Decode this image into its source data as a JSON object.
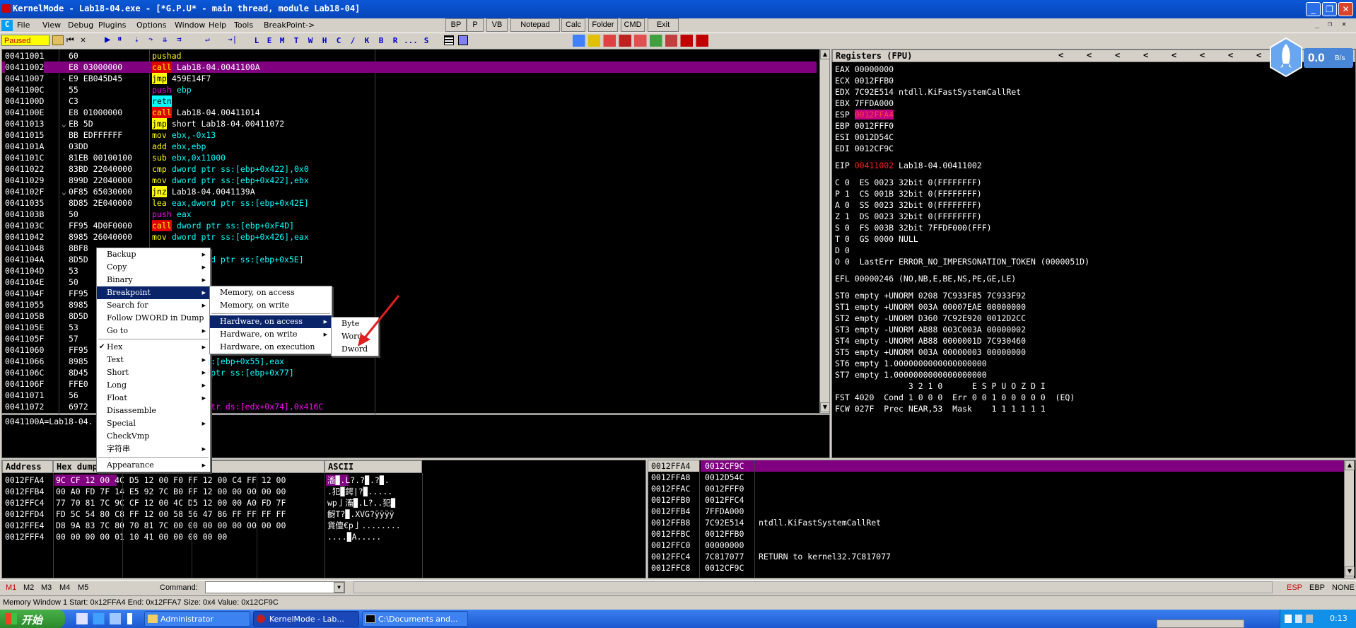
{
  "window": {
    "title": "KernelMode - Lab18-04.exe - [*G.P.U* - main thread, module Lab18-04]"
  },
  "menu": [
    "File",
    "View",
    "Debug",
    "Plugins",
    "Options",
    "Window",
    "Help",
    "Tools",
    "BreakPoint->"
  ],
  "top_buttons": [
    "BP",
    "P",
    "VB",
    "Notepad",
    "Calc",
    "Folder",
    "CMD",
    "Exit"
  ],
  "status_box": "Paused",
  "toolbar_letters": [
    "L",
    "E",
    "M",
    "T",
    "W",
    "H",
    "C",
    "/",
    "K",
    "B",
    "R",
    "...",
    "S"
  ],
  "cpu": {
    "rows": [
      {
        "addr": "00411001",
        "hex": "60",
        "mark": "",
        "mn": "pushad",
        "mncls": "kw-mov",
        "ops": "",
        "opcls": "ops-white"
      },
      {
        "addr": "00411002",
        "hex": "E8 03000000",
        "mark": "",
        "mn": "call",
        "mncls": "kw-call",
        "ops": " Lab18-04.0041100A",
        "opcls": "ops-white",
        "sel": true
      },
      {
        "addr": "00411007",
        "hex": "E9 EB045D45",
        "mark": "-",
        "mn": "jmp",
        "mncls": "kw-jmp",
        "ops": " 459E14F7",
        "opcls": "ops-white"
      },
      {
        "addr": "0041100C",
        "hex": "55",
        "mark": "",
        "mn": "push",
        "mncls": "kw-push",
        "ops": " ebp",
        "opcls": "ops-cyan"
      },
      {
        "addr": "0041100D",
        "hex": "C3",
        "mark": "",
        "mn": "retn",
        "mncls": "kw-retn",
        "ops": "",
        "opcls": "ops-white"
      },
      {
        "addr": "0041100E",
        "hex": "E8 01000000",
        "mark": "",
        "mn": "call",
        "mncls": "kw-call",
        "ops": " Lab18-04.00411014",
        "opcls": "ops-white"
      },
      {
        "addr": "00411013",
        "hex": "EB 5D",
        "mark": "⌄",
        "mn": "jmp",
        "mncls": "kw-jmp",
        "ops": " short Lab18-04.00411072",
        "opcls": "ops-white"
      },
      {
        "addr": "00411015",
        "hex": "BB EDFFFFFF",
        "mark": "",
        "mn": "mov",
        "mncls": "kw-mov",
        "ops": " ebx,-0x13",
        "opcls": "ops-cyan"
      },
      {
        "addr": "0041101A",
        "hex": "03DD",
        "mark": "",
        "mn": "add",
        "mncls": "kw-add",
        "ops": " ebx,ebp",
        "opcls": "ops-cyan"
      },
      {
        "addr": "0041101C",
        "hex": "81EB 00100100",
        "mark": "",
        "mn": "sub",
        "mncls": "kw-sub",
        "ops": " ebx,0x11000",
        "opcls": "ops-cyan"
      },
      {
        "addr": "00411022",
        "hex": "83BD 22040000",
        "mark": "",
        "mn": "cmp",
        "mncls": "kw-cmp",
        "ops": " dword ptr ss:[ebp+0x422],0x0",
        "opcls": "ops-cyan"
      },
      {
        "addr": "00411029",
        "hex": "899D 22040000",
        "mark": "",
        "mn": "mov",
        "mncls": "kw-mov",
        "ops": " dword ptr ss:[ebp+0x422],ebx",
        "opcls": "ops-cyan"
      },
      {
        "addr": "0041102F",
        "hex": "0F85 65030000",
        "mark": "⌄",
        "mn": "jnz",
        "mncls": "kw-jnz",
        "ops": " Lab18-04.0041139A",
        "opcls": "ops-white"
      },
      {
        "addr": "00411035",
        "hex": "8D85 2E040000",
        "mark": "",
        "mn": "lea",
        "mncls": "kw-lea",
        "ops": " eax,dword ptr ss:[ebp+0x42E]",
        "opcls": "ops-cyan"
      },
      {
        "addr": "0041103B",
        "hex": "50",
        "mark": "",
        "mn": "push",
        "mncls": "kw-push",
        "ops": " eax",
        "opcls": "ops-cyan"
      },
      {
        "addr": "0041103C",
        "hex": "FF95 4D0F0000",
        "mark": "",
        "mn": "call",
        "mncls": "kw-call",
        "ops": " dword ptr ss:[ebp+0xF4D]",
        "opcls": "ops-cyan"
      },
      {
        "addr": "00411042",
        "hex": "8985 26040000",
        "mark": "",
        "mn": "mov",
        "mncls": "kw-mov",
        "ops": " dword ptr ss:[ebp+0x426],eax",
        "opcls": "ops-cyan"
      },
      {
        "addr": "00411048",
        "hex": "8BF8",
        "mark": "",
        "mn": "",
        "mncls": "",
        "ops": "",
        "opcls": "ops-white"
      },
      {
        "addr": "0041104A",
        "hex": "8D5D",
        "mark": "",
        "mn": "",
        "mncls": "",
        "ops": "        dword ptr ss:[ebp+0x5E]",
        "opcls": "ops-cyan"
      },
      {
        "addr": "0041104D",
        "hex": "53",
        "mark": "",
        "mn": "",
        "mncls": "",
        "ops": "",
        "opcls": "ops-white"
      },
      {
        "addr": "0041104E",
        "hex": "50",
        "mark": "",
        "mn": "",
        "mncls": "",
        "ops": "",
        "opcls": "ops-white"
      },
      {
        "addr": "0041104F",
        "hex": "FF95",
        "mark": "",
        "mn": "",
        "mncls": "",
        "ops": "",
        "opcls": "ops-white"
      },
      {
        "addr": "00411055",
        "hex": "8985",
        "mark": "",
        "mn": "",
        "mncls": "",
        "ops": "",
        "opcls": "ops-white"
      },
      {
        "addr": "0041105B",
        "hex": "8D5D",
        "mark": "",
        "mn": "",
        "mncls": "",
        "ops": "",
        "opcls": "ops-white"
      },
      {
        "addr": "0041105E",
        "hex": "53",
        "mark": "",
        "mn": "",
        "mncls": "",
        "ops": "",
        "opcls": "ops-white"
      },
      {
        "addr": "0041105F",
        "hex": "57",
        "mark": "",
        "mn": "",
        "mncls": "",
        "ops": "",
        "opcls": "ops-white"
      },
      {
        "addr": "00411060",
        "hex": "FF95",
        "mark": "",
        "mn": "",
        "mncls": "",
        "ops": "",
        "opcls": "ops-white"
      },
      {
        "addr": "00411066",
        "hex": "8985",
        "mark": "",
        "mn": "",
        "mncls": "",
        "ops": "      ptr ss:[ebp+0x55],eax",
        "opcls": "ops-cyan"
      },
      {
        "addr": "0041106C",
        "hex": "8D45",
        "mark": "",
        "mn": "",
        "mncls": "",
        "ops": "      dword ptr ss:[ebp+0x77]",
        "opcls": "ops-cyan"
      },
      {
        "addr": "0041106F",
        "hex": "FFE0",
        "mark": "",
        "mn": "",
        "mncls": "",
        "ops": "",
        "opcls": "ops-white"
      },
      {
        "addr": "00411071",
        "hex": "56",
        "mark": "",
        "mn": "",
        "mncls": "",
        "ops": "",
        "opcls": "ops-white"
      },
      {
        "addr": "00411072",
        "hex": "6972",
        "mark": "",
        "mn": "",
        "mncls": "",
        "ops": "     dword ptr ds:[edx+0x74],0x416C",
        "opcls": "ops-mag"
      }
    ],
    "info": "0041100A=Lab18-04."
  },
  "registers": {
    "header": "Registers (FPU)",
    "lines": [
      {
        "name": "EAX",
        "val": "00000000",
        "extra": ""
      },
      {
        "name": "ECX",
        "val": "0012FFB0",
        "extra": ""
      },
      {
        "name": "EDX",
        "val": "7C92E514",
        "extra": " ntdll.KiFastSystemCallRet"
      },
      {
        "name": "EBX",
        "val": "7FFDA000",
        "extra": ""
      },
      {
        "name": "ESP",
        "val": "0012FFA4",
        "extra": "",
        "hl": true
      },
      {
        "name": "EBP",
        "val": "0012FFF0",
        "extra": ""
      },
      {
        "name": "ESI",
        "val": "0012D54C",
        "extra": ""
      },
      {
        "name": "EDI",
        "val": "0012CF9C",
        "extra": ""
      }
    ],
    "eip": {
      "name": "EIP",
      "val": "00411002",
      "extra": " Lab18-04.00411002"
    },
    "flags": [
      "C 0  ES 0023 32bit 0(FFFFFFFF)",
      "P 1  CS 001B 32bit 0(FFFFFFFF)",
      "A 0  SS 0023 32bit 0(FFFFFFFF)",
      "Z 1  DS 0023 32bit 0(FFFFFFFF)",
      "S 0  FS 003B 32bit 7FFDF000(FFF)",
      "T 0  GS 0000 NULL",
      "D 0",
      "O 0  LastErr ERROR_NO_IMPERSONATION_TOKEN (0000051D)"
    ],
    "efl": "EFL 00000246 (NO,NB,E,BE,NS,PE,GE,LE)",
    "fpu": [
      "ST0 empty +UNORM 0208 7C933F85 7C933F92",
      "ST1 empty +UNORM 003A 00007EAE 00000000",
      "ST2 empty -UNORM D360 7C92E920 0012D2CC",
      "ST3 empty -UNORM AB88 003C003A 00000002",
      "ST4 empty -UNORM AB88 0000001D 7C930460",
      "ST5 empty +UNORM 003A 00000003 00000000",
      "ST6 empty 1.0000000000000000000",
      "ST7 empty 1.0000000000000000000",
      "               3 2 1 0      E S P U O Z D I",
      "FST 4020  Cond 1 0 0 0  Err 0 0 1 0 0 0 0 0  (EQ)",
      "FCW 027F  Prec NEAR,53  Mask    1 1 1 1 1 1"
    ],
    "arrows": [
      "<",
      "<",
      "<",
      "<",
      "<",
      "<",
      "<",
      "<"
    ]
  },
  "speed": {
    "value": "0.0",
    "unit": "B/s"
  },
  "dump": {
    "headers": [
      "Address",
      "Hex dump",
      "ASCII"
    ],
    "rows": [
      {
        "addr": "0012FFA4",
        "hex": "9C CF 12 00 4C D5 12 00 F0 FF 12 00 C4 FF 12 00",
        "ascii": "滀▉.L?.?▉.?▉."
      },
      {
        "addr": "0012FFB4",
        "hex": "00 A0 FD 7F 14 E5 92 7C B0 FF 12 00 00 00 00 00",
        "ascii": ".犯▉鍔|?▉....."
      },
      {
        "addr": "0012FFC4",
        "hex": "77 70 81 7C 9C CF 12 00 4C D5 12 00 00 A0 FD 7F",
        "ascii": "wp亅滀▉.L?..犯▉"
      },
      {
        "addr": "0012FFD4",
        "hex": "FD 5C 54 80 C8 FF 12 00 58 56 47 86 FF FF FF FF",
        "ascii": "齖T?▉.XVG?ÿÿÿÿ"
      },
      {
        "addr": "0012FFE4",
        "hex": "D8 9A 83 7C 80 70 81 7C 00 00 00 00 00 00 00 00",
        "ascii": "貨儃€p亅........"
      },
      {
        "addr": "0012FFF4",
        "hex": "00 00 00 00 01 10 41 00 00 00 00 00",
        "ascii": "....▉A....."
      }
    ]
  },
  "stack": {
    "top": {
      "addr": "0012FFA4",
      "val": "0012CF9C"
    },
    "rows": [
      {
        "addr": "0012FFA8",
        "val": "0012D54C",
        "c": ""
      },
      {
        "addr": "0012FFAC",
        "val": "0012FFF0",
        "c": ""
      },
      {
        "addr": "0012FFB0",
        "val": "0012FFC4",
        "c": ""
      },
      {
        "addr": "0012FFB4",
        "val": "7FFDA000",
        "c": ""
      },
      {
        "addr": "0012FFB8",
        "val": "7C92E514",
        "c": "ntdll.KiFastSystemCallRet"
      },
      {
        "addr": "0012FFBC",
        "val": "0012FFB0",
        "c": ""
      },
      {
        "addr": "0012FFC0",
        "val": "00000000",
        "c": ""
      },
      {
        "addr": "0012FFC4",
        "val": "7C817077",
        "c": "RETURN to kernel32.7C817077"
      },
      {
        "addr": "0012FFC8",
        "val": "0012CF9C",
        "c": ""
      }
    ]
  },
  "cmdbar": {
    "m": [
      "M1",
      "M2",
      "M3",
      "M4",
      "M5"
    ],
    "label": "Command:",
    "regs": [
      "ESP",
      "EBP",
      "NONE"
    ]
  },
  "statusline": "Memory Window 1  Start: 0x12FFA4  End: 0x12FFA7  Size: 0x4 Value: 0x12CF9C",
  "context_menu": {
    "items": [
      {
        "label": "Backup",
        "arrow": true
      },
      {
        "label": "Copy",
        "arrow": true
      },
      {
        "label": "Binary",
        "arrow": true
      },
      {
        "label": "Breakpoint",
        "arrow": true,
        "sel": true
      },
      {
        "label": "Search for",
        "arrow": true
      },
      {
        "label": "Follow DWORD in Dump",
        "arrow": false
      },
      {
        "label": "Go to",
        "arrow": true
      },
      {
        "sep": true
      },
      {
        "label": "Hex",
        "arrow": true,
        "check": true
      },
      {
        "label": "Text",
        "arrow": true
      },
      {
        "label": "Short",
        "arrow": true
      },
      {
        "label": "Long",
        "arrow": true
      },
      {
        "label": "Float",
        "arrow": true
      },
      {
        "label": "Disassemble",
        "arrow": false
      },
      {
        "label": "Special",
        "arrow": true
      },
      {
        "label": "CheckVmp",
        "arrow": false
      },
      {
        "label": "字符串",
        "arrow": true
      },
      {
        "sep": true
      },
      {
        "label": "Appearance",
        "arrow": true
      }
    ],
    "submenu1": [
      {
        "label": "Memory, on access"
      },
      {
        "label": "Memory, on write"
      },
      {
        "sep": true
      },
      {
        "label": "Hardware, on access",
        "arrow": true,
        "sel": true
      },
      {
        "label": "Hardware, on write",
        "arrow": true
      },
      {
        "label": "Hardware, on execution"
      }
    ],
    "submenu2": [
      {
        "label": "Byte"
      },
      {
        "label": "Word"
      },
      {
        "label": "Dword"
      }
    ]
  },
  "taskbar": {
    "start": "开始",
    "tasks": [
      "Administrator",
      "KernelMode - Lab...",
      "C:\\Documents and..."
    ],
    "clock": "0:13"
  }
}
